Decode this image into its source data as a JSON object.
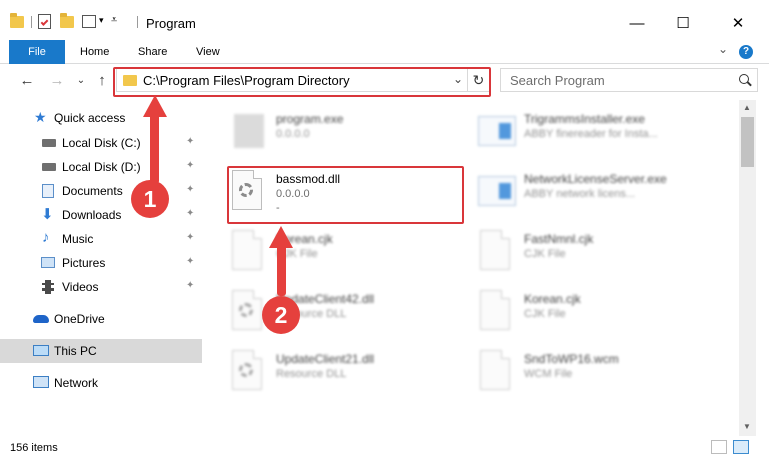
{
  "window": {
    "title": "Program",
    "minimize": "—",
    "maximize": "☐",
    "close": "✕"
  },
  "ribbon": {
    "tabs": [
      "File",
      "Home",
      "Share",
      "View"
    ],
    "expand": "⌄",
    "help": "?"
  },
  "nav": {
    "back": "←",
    "forward": "→",
    "recent": "⌄",
    "up": "↑",
    "address": "C:\\Program Files\\Program Directory",
    "address_chevron": "⌄",
    "refresh": "↻",
    "search_placeholder": "Search Program"
  },
  "sidebar": {
    "items": [
      {
        "label": "Quick access",
        "icon": "star-icon",
        "pinned": false
      },
      {
        "label": "Local Disk (C:)",
        "icon": "drive-icon",
        "pinned": true
      },
      {
        "label": "Local Disk (D:)",
        "icon": "drive-icon",
        "pinned": true
      },
      {
        "label": "Documents",
        "icon": "documents-icon",
        "pinned": true
      },
      {
        "label": "Downloads",
        "icon": "download-icon",
        "pinned": true
      },
      {
        "label": "Music",
        "icon": "music-icon",
        "pinned": true
      },
      {
        "label": "Pictures",
        "icon": "pictures-icon",
        "pinned": true
      },
      {
        "label": "Videos",
        "icon": "videos-icon",
        "pinned": true
      },
      {
        "label": "OneDrive",
        "icon": "cloud-icon",
        "pinned": false
      },
      {
        "label": "This PC",
        "icon": "computer-icon",
        "pinned": false
      },
      {
        "label": "Network",
        "icon": "network-icon",
        "pinned": false
      }
    ],
    "pin_glyph": "📌"
  },
  "files": {
    "left": [
      {
        "name": "program.exe",
        "sub": "0.0.0.0",
        "sub2": ""
      },
      {
        "name": "bassmod.dll",
        "sub": "0.0.0.0",
        "sub2": "-"
      },
      {
        "name": "Korean.cjk",
        "sub": "CJK File",
        "sub2": ""
      },
      {
        "name": "UpdateClient42.dll",
        "sub": "Resource DLL",
        "sub2": ""
      },
      {
        "name": "UpdateClient21.dll",
        "sub": "Resource DLL",
        "sub2": ""
      }
    ],
    "right": [
      {
        "name": "TrigrammsInstaller.exe",
        "sub": "ABBY finereader for Insta...",
        "sub2": ""
      },
      {
        "name": "NetworkLicenseServer.exe",
        "sub": "ABBY network licens...",
        "sub2": ""
      },
      {
        "name": "FastNmnl.cjk",
        "sub": "CJK File",
        "sub2": ""
      },
      {
        "name": "Korean.cjk",
        "sub": "CJK File",
        "sub2": ""
      },
      {
        "name": "SndToWP16.wcm",
        "sub": "WCM File",
        "sub2": ""
      }
    ]
  },
  "status": {
    "item_count": "156 items"
  },
  "annotations": {
    "step1": "1",
    "step2": "2",
    "accent": "#e5403d"
  }
}
